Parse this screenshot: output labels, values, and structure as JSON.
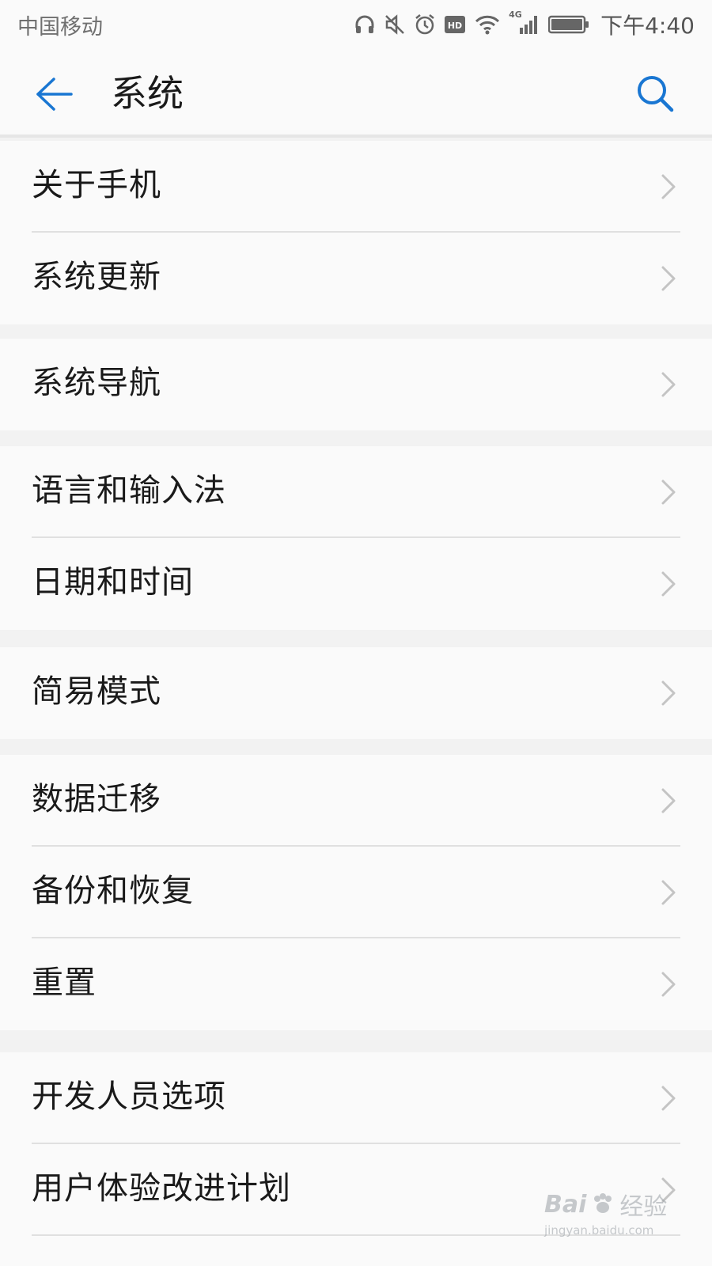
{
  "status_bar": {
    "carrier": "中国移动",
    "network": "4G",
    "hd_badge": "HD",
    "time": "下午4:40",
    "icons": [
      "headphones-icon",
      "mute-icon",
      "alarm-icon",
      "hd-icon",
      "wifi-icon",
      "signal-icon",
      "battery-icon"
    ]
  },
  "header": {
    "title": "系统",
    "accent_color": "#1976d2"
  },
  "groups": [
    [
      "关于手机",
      "系统更新"
    ],
    [
      "系统导航"
    ],
    [
      "语言和输入法",
      "日期和时间"
    ],
    [
      "简易模式"
    ],
    [
      "数据迁移",
      "备份和恢复",
      "重置"
    ],
    [
      "开发人员选项",
      "用户体验改进计划"
    ]
  ],
  "watermark": {
    "brand": "Bai",
    "brand_suffix": "经验",
    "url": "jingyan.baidu.com"
  }
}
